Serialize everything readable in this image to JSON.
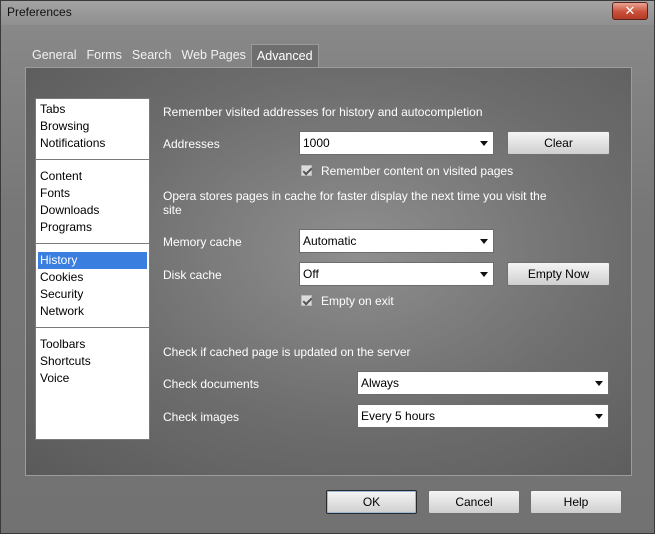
{
  "window": {
    "title": "Preferences",
    "close_glyph": "✕"
  },
  "tabs": [
    {
      "label": "General"
    },
    {
      "label": "Forms"
    },
    {
      "label": "Search"
    },
    {
      "label": "Web Pages"
    },
    {
      "label": "Advanced"
    }
  ],
  "active_tab": "Advanced",
  "nav": {
    "groups": [
      [
        "Tabs",
        "Browsing",
        "Notifications"
      ],
      [
        "Content",
        "Fonts",
        "Downloads",
        "Programs"
      ],
      [
        "History",
        "Cookies",
        "Security",
        "Network"
      ],
      [
        "Toolbars",
        "Shortcuts",
        "Voice"
      ]
    ],
    "selected": "History"
  },
  "history": {
    "remember_heading": "Remember visited addresses for history and autocompletion",
    "addresses_label": "Addresses",
    "addresses_value": "1000",
    "clear_label": "Clear",
    "remember_content_label": "Remember content on visited pages",
    "remember_content_checked": true,
    "cache_heading": "Opera stores pages in cache for faster display the next time you visit the site",
    "memory_cache_label": "Memory cache",
    "memory_cache_value": "Automatic",
    "disk_cache_label": "Disk cache",
    "disk_cache_value": "Off",
    "empty_now_label": "Empty Now",
    "empty_on_exit_label": "Empty on exit",
    "empty_on_exit_checked": true,
    "check_heading": "Check if cached page is updated on the server",
    "check_documents_label": "Check documents",
    "check_documents_value": "Always",
    "check_images_label": "Check images",
    "check_images_value": "Every 5 hours"
  },
  "footer": {
    "ok_label": "OK",
    "cancel_label": "Cancel",
    "help_label": "Help"
  }
}
